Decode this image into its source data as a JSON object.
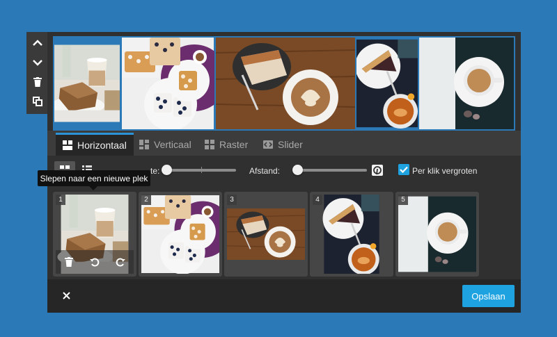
{
  "toolbar": {
    "icons": [
      "chevron-up-icon",
      "chevron-down-icon",
      "trash-icon",
      "copy-icon"
    ]
  },
  "gallery": {
    "images": [
      "latte-and-cake",
      "breakfast-waffles",
      "cake-and-cappuccino",
      "tart-and-coffee",
      "coffee-cup-dark"
    ]
  },
  "tabs": {
    "horizontal": "Horizontaal",
    "vertical": "Verticaal",
    "grid": "Raster",
    "slider": "Slider",
    "active": "horizontal"
  },
  "controls": {
    "height_label_partial": "te:",
    "spacing_label": "Afstand:",
    "enlarge_label": "Per klik vergroten",
    "enlarge_checked": true,
    "tooltip": "Slepen naar een nieuwe plek",
    "height_slider_value": 0.0,
    "spacing_slider_value": 0.0
  },
  "thumbnails": [
    {
      "number": "1",
      "image": "latte-and-cake"
    },
    {
      "number": "2",
      "image": "breakfast-waffles"
    },
    {
      "number": "3",
      "image": "cake-and-cappuccino"
    },
    {
      "number": "4",
      "image": "tart-and-coffee"
    },
    {
      "number": "5",
      "image": "coffee-cup-dark"
    }
  ],
  "footer": {
    "save_label": "Opslaan",
    "close_icon": "close-icon"
  },
  "colors": {
    "background": "#2b7ab7",
    "panel": "#303030",
    "accent": "#1fa2e0",
    "tab_active_border": "#2b94d6"
  }
}
